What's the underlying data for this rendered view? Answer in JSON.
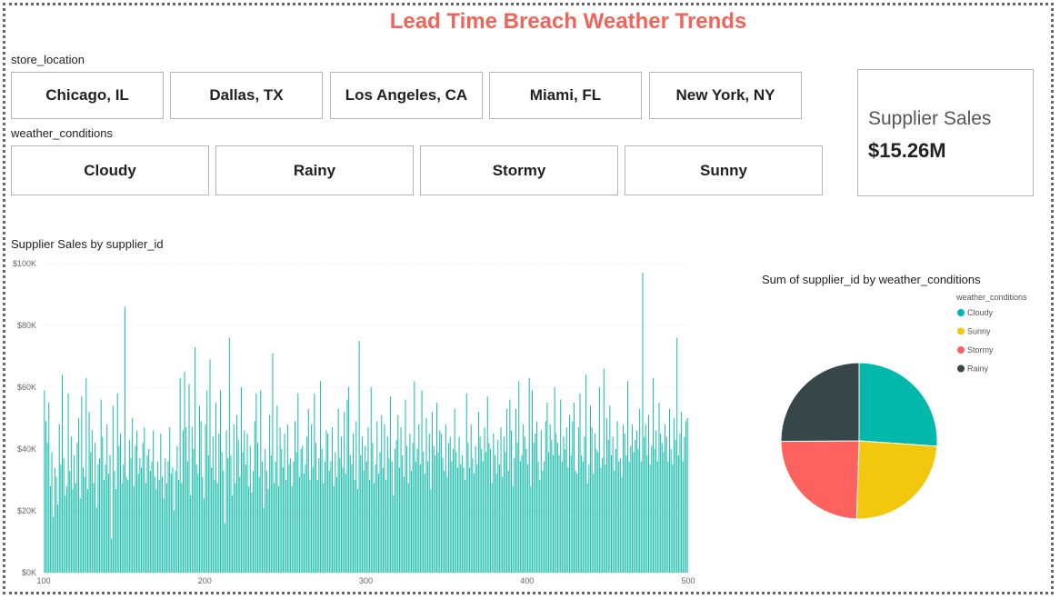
{
  "page": {
    "title": "Lead Time Breach Weather Trends"
  },
  "slicers": {
    "store_location": {
      "label": "store_location",
      "items": [
        "Chicago, IL",
        "Dallas, TX",
        "Los Angeles, CA",
        "Miami, FL",
        "New York, NY"
      ]
    },
    "weather_conditions": {
      "label": "weather_conditions",
      "items": [
        "Cloudy",
        "Rainy",
        "Stormy",
        "Sunny"
      ]
    }
  },
  "kpi": {
    "label": "Supplier Sales",
    "value": "$15.26M"
  },
  "colors": {
    "title": "#f0645a",
    "bar": "#1abcac",
    "cloudy": "#01b8aa",
    "sunny": "#f2c80f",
    "stormy": "#fd625e",
    "rainy": "#374649"
  },
  "chart_data": [
    {
      "type": "bar",
      "title": "Supplier Sales by supplier_id",
      "xlabel": "",
      "ylabel": "",
      "x_range": [
        100,
        500
      ],
      "ylim": [
        0,
        100000
      ],
      "y_ticks": [
        "$0K",
        "$20K",
        "$40K",
        "$60K",
        "$80K",
        "$100K"
      ],
      "x_ticks": [
        "100",
        "200",
        "300",
        "400",
        "500"
      ],
      "grid": true,
      "values": [
        59000,
        49000,
        42000,
        55000,
        28000,
        39000,
        18000,
        34000,
        31000,
        22000,
        48000,
        35000,
        64000,
        37000,
        25000,
        28000,
        58000,
        33000,
        44000,
        27000,
        38000,
        29000,
        42000,
        50000,
        24000,
        57000,
        34000,
        31000,
        63000,
        27000,
        52000,
        39000,
        46000,
        29000,
        42000,
        21000,
        35000,
        37000,
        56000,
        44000,
        30000,
        35000,
        48000,
        32000,
        38000,
        11000,
        54000,
        33000,
        27000,
        58000,
        41000,
        45000,
        29000,
        35000,
        86000,
        31000,
        30000,
        43000,
        37000,
        50000,
        28000,
        41000,
        46000,
        32000,
        37000,
        34000,
        42000,
        47000,
        29000,
        38000,
        40000,
        33000,
        36000,
        46000,
        31000,
        27000,
        36000,
        30000,
        45000,
        31000,
        24000,
        37000,
        29000,
        36000,
        47000,
        32000,
        34000,
        20000,
        33000,
        41000,
        30000,
        63000,
        29000,
        46000,
        65000,
        47000,
        36000,
        61000,
        25000,
        47000,
        40000,
        73000,
        35000,
        32000,
        54000,
        49000,
        31000,
        24000,
        48000,
        59000,
        38000,
        69000,
        34000,
        44000,
        30000,
        55000,
        29000,
        45000,
        59000,
        39000,
        33000,
        16000,
        46000,
        37000,
        76000,
        38000,
        25000,
        48000,
        29000,
        51000,
        43000,
        31000,
        60000,
        39000,
        46000,
        35000,
        45000,
        28000,
        41000,
        26000,
        33000,
        49000,
        58000,
        42000,
        31000,
        59000,
        36000,
        21000,
        40000,
        33000,
        27000,
        51000,
        38000,
        71000,
        29000,
        36000,
        54000,
        28000,
        47000,
        40000,
        34000,
        45000,
        30000,
        48000,
        35000,
        37000,
        28000,
        36000,
        49000,
        39000,
        58000,
        31000,
        40000,
        41000,
        32000,
        35000,
        44000,
        53000,
        30000,
        48000,
        34000,
        58000,
        42000,
        30000,
        37000,
        62000,
        40000,
        29000,
        36000,
        46000,
        45000,
        33000,
        36000,
        47000,
        28000,
        39000,
        31000,
        53000,
        37000,
        44000,
        34000,
        52000,
        32000,
        56000,
        60000,
        38000,
        35000,
        45000,
        30000,
        49000,
        27000,
        75000,
        38000,
        44000,
        33000,
        41000,
        36000,
        47000,
        30000,
        60000,
        42000,
        29000,
        35000,
        49000,
        32000,
        39000,
        51000,
        34000,
        48000,
        30000,
        44000,
        37000,
        57000,
        36000,
        25000,
        40000,
        43000,
        51000,
        34000,
        47000,
        38000,
        31000,
        56000,
        41000,
        29000,
        45000,
        33000,
        42000,
        62000,
        36000,
        40000,
        48000,
        35000,
        59000,
        39000,
        32000,
        50000,
        36000,
        45000,
        27000,
        52000,
        41000,
        38000,
        55000,
        39000,
        46000,
        45000,
        37000,
        33000,
        48000,
        31000,
        42000,
        44000,
        36000,
        40000,
        53000,
        39000,
        34000,
        44000,
        35000,
        38000,
        34000,
        30000,
        58000,
        42000,
        34000,
        48000,
        37000,
        32000,
        41000,
        35000,
        52000,
        44000,
        40000,
        36000,
        47000,
        39000,
        57000,
        42000,
        40000,
        29000,
        45000,
        38000,
        32000,
        43000,
        35000,
        47000,
        31000,
        44000,
        39000,
        53000,
        33000,
        56000,
        46000,
        28000,
        37000,
        53000,
        42000,
        62000,
        36000,
        38000,
        48000,
        44000,
        40000,
        35000,
        63000,
        28000,
        59000,
        42000,
        45000,
        49000,
        36000,
        30000,
        46000,
        33000,
        36000,
        49000,
        55000,
        39000,
        48000,
        43000,
        38000,
        60000,
        45000,
        42000,
        38000,
        56000,
        36000,
        44000,
        40000,
        47000,
        34000,
        51000,
        38000,
        49000,
        55000,
        33000,
        32000,
        47000,
        58000,
        38000,
        36000,
        44000,
        64000,
        29000,
        35000,
        54000,
        47000,
        32000,
        45000,
        40000,
        39000,
        60000,
        34000,
        37000,
        66000,
        35000,
        50000,
        43000,
        54000,
        38000,
        44000,
        33000,
        40000,
        49000,
        36000,
        37000,
        31000,
        48000,
        45000,
        38000,
        62000,
        36000,
        41000,
        48000,
        39000,
        43000,
        46000,
        40000,
        53000,
        36000,
        97000,
        44000,
        48000,
        38000,
        51000,
        35000,
        41000,
        63000,
        40000,
        46000,
        36000,
        55000,
        45000,
        42000,
        39000,
        48000,
        44000,
        36000,
        53000,
        40000,
        35000,
        50000,
        43000,
        76000,
        38000,
        45000,
        52000,
        36000,
        44000,
        49000,
        50000
      ]
    },
    {
      "type": "pie",
      "title": "Sum of supplier_id by weather_conditions",
      "legend_title": "weather_conditions",
      "legend_placement": "top-right",
      "labels": [
        "Cloudy",
        "Sunny",
        "Stormy",
        "Rainy"
      ],
      "values": [
        26.1,
        24.4,
        24.4,
        25.1
      ]
    }
  ]
}
